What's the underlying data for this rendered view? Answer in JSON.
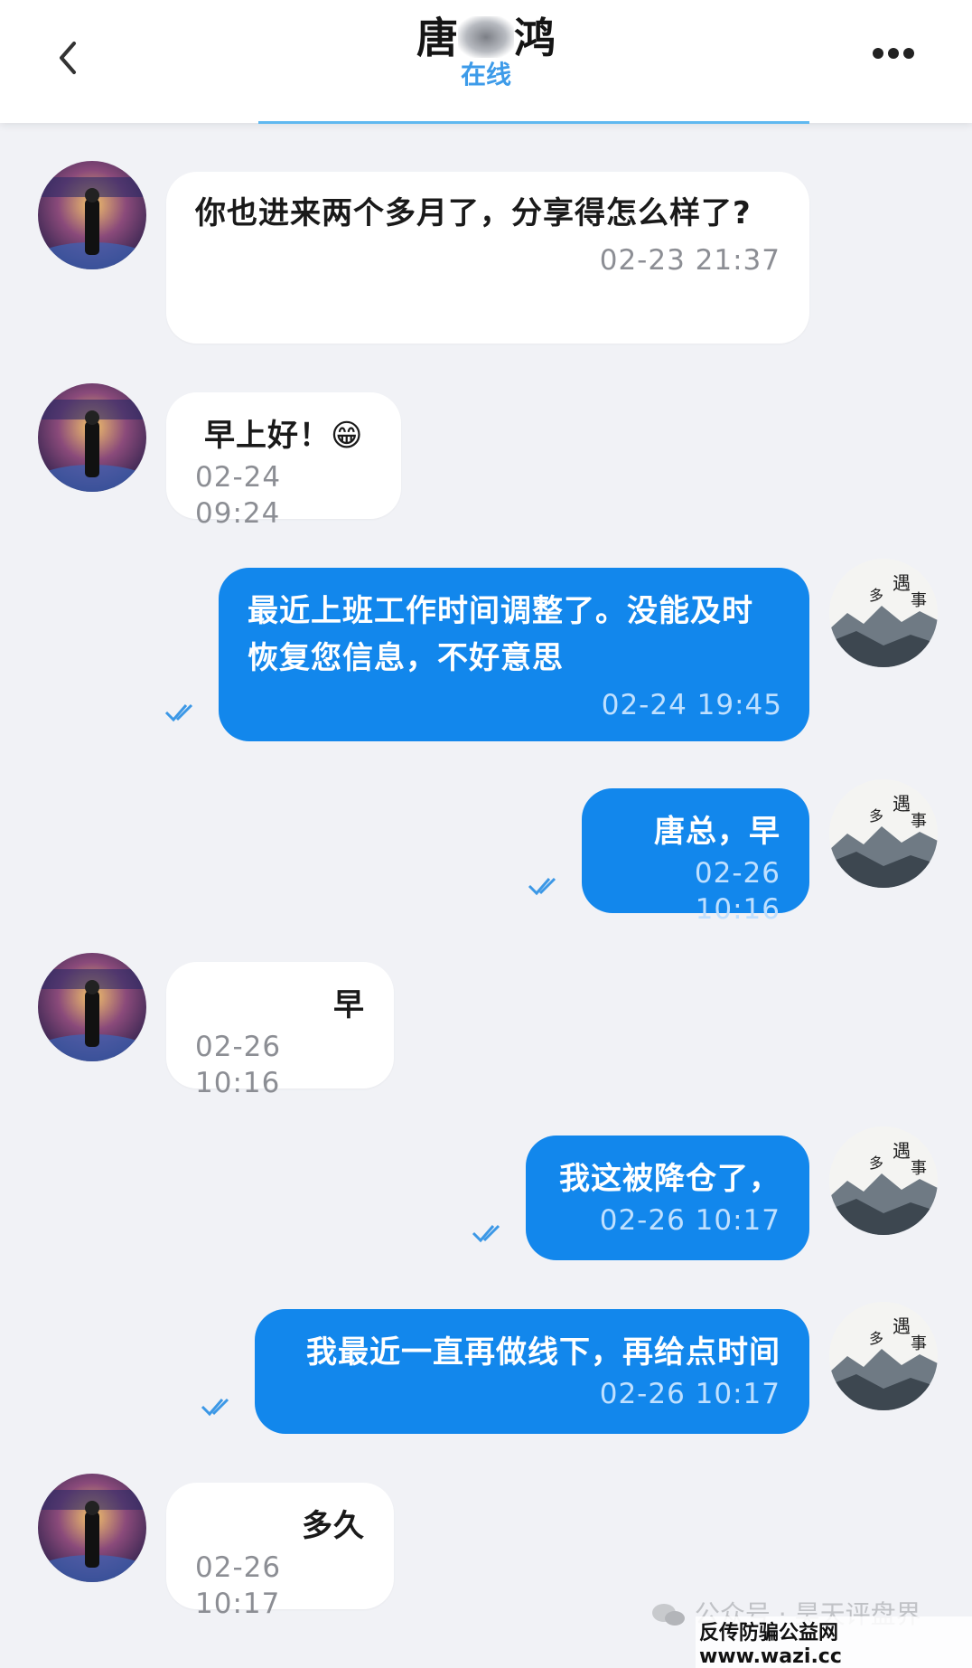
{
  "header": {
    "title_prefix": "唐",
    "title_suffix": "鸿",
    "status": "在线"
  },
  "messages": [
    {
      "side": "in",
      "text": "你也进来两个多月了，分享得怎么样了?",
      "time": "02-23 21:37"
    },
    {
      "side": "in",
      "text": "早上好！😁",
      "time": "02-24 09:24"
    },
    {
      "side": "out",
      "text": "最近上班工作时间调整了。没能及时恢复您信息，不好意思",
      "time": "02-24 19:45",
      "read": true
    },
    {
      "side": "out",
      "text": "唐总，早",
      "time": "02-26 10:16",
      "read": true
    },
    {
      "side": "in",
      "text": "早",
      "time": "02-26 10:16"
    },
    {
      "side": "out",
      "text": "我这被降仓了，",
      "time": "02-26 10:17",
      "read": true
    },
    {
      "side": "out",
      "text": "我最近一直再做线下，再给点时间",
      "time": "02-26 10:17",
      "read": true
    },
    {
      "side": "in",
      "text": "多久",
      "time": "02-26 10:17"
    }
  ],
  "watermark": {
    "line1": "公众号 · 昊天评盘界",
    "line2": "反传防骗公益网 www.wazi.cc"
  },
  "colors": {
    "outgoing_bubble": "#1287ec",
    "incoming_bubble": "#ffffff",
    "status": "#3d9be9",
    "background": "#f1f2f6"
  },
  "icons": [
    "back-icon",
    "more-icon",
    "double-check-icon",
    "wechat-icon"
  ]
}
